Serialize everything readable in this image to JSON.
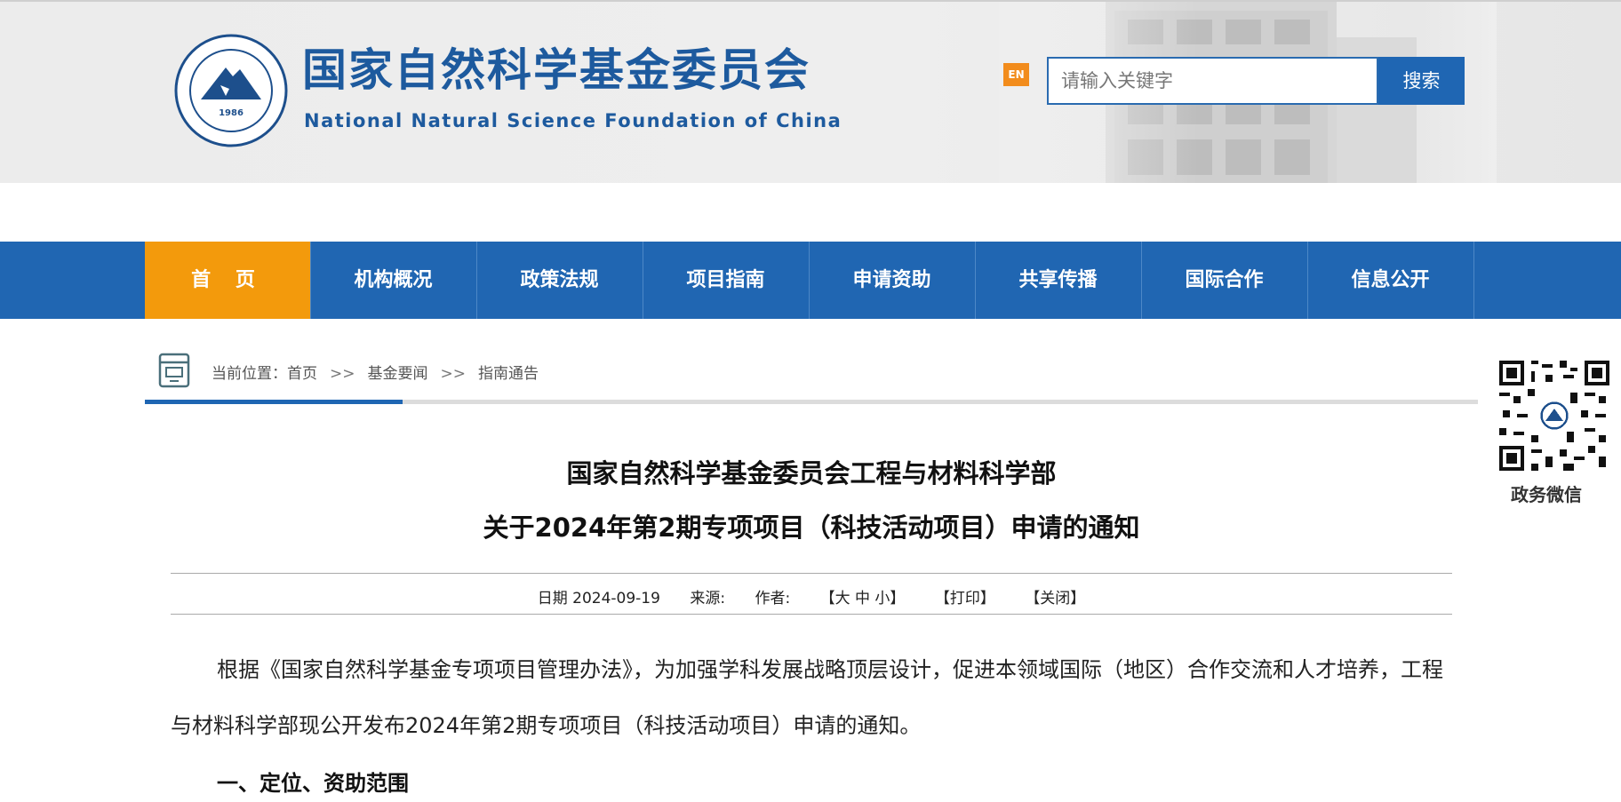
{
  "header": {
    "site_title": "国家自然科学基金委员会",
    "site_title_en": "National Natural Science Foundation of China",
    "logo_year": "1986",
    "en_label": "EN",
    "search_placeholder": "请输入关键字",
    "search_button": "搜索"
  },
  "nav": {
    "items": [
      {
        "label": "首 页",
        "active": true
      },
      {
        "label": "机构概况"
      },
      {
        "label": "政策法规"
      },
      {
        "label": "项目指南"
      },
      {
        "label": "申请资助"
      },
      {
        "label": "共享传播"
      },
      {
        "label": "国际合作"
      },
      {
        "label": "信息公开"
      }
    ]
  },
  "breadcrumb": {
    "prefix": "当前位置：",
    "items": [
      "首页",
      "基金要闻",
      "指南通告"
    ],
    "separator": ">>"
  },
  "sidebar": {
    "qr_label": "政务微信"
  },
  "article": {
    "title_line1": "国家自然科学基金委员会工程与材料科学部",
    "title_line2": "关于2024年第2期专项项目（科技活动项目）申请的通知",
    "meta": {
      "date": "日期 2024-09-19",
      "source": "来源:",
      "author": "作者:",
      "font_size": "【大 中 小】",
      "print": "【打印】",
      "close": "【关闭】"
    },
    "paragraph1": "根据《国家自然科学基金专项项目管理办法》，为加强学科发展战略顶层设计，促进本领域国际（地区）合作交流和人才培养，工程与材料科学部现公开发布2024年第2期专项项目（科技活动项目）申请的通知。",
    "section1": "一、定位、资助范围"
  },
  "colors": {
    "brand_blue": "#1f66b3",
    "nav_active": "#f39a0c",
    "en_orange": "#f28c1c"
  }
}
